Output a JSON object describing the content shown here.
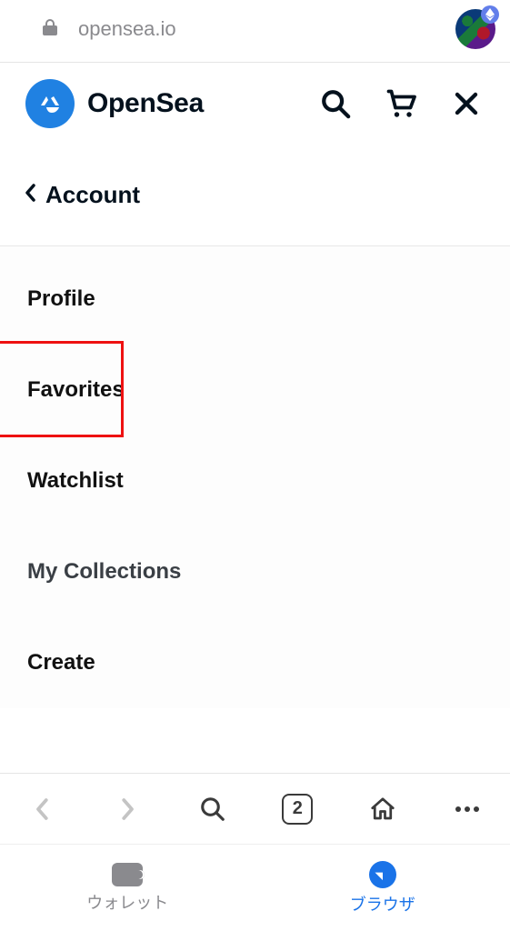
{
  "url": "opensea.io",
  "brand": "OpenSea",
  "back_label": "Account",
  "menu": {
    "items": [
      {
        "label": "Profile"
      },
      {
        "label": "Favorites",
        "highlighted": true
      },
      {
        "label": "Watchlist"
      },
      {
        "label": "My Collections"
      },
      {
        "label": "Create"
      }
    ]
  },
  "browser_nav": {
    "tab_count": "2"
  },
  "app_nav": {
    "wallet_label": "ウォレット",
    "browser_label": "ブラウザ"
  }
}
